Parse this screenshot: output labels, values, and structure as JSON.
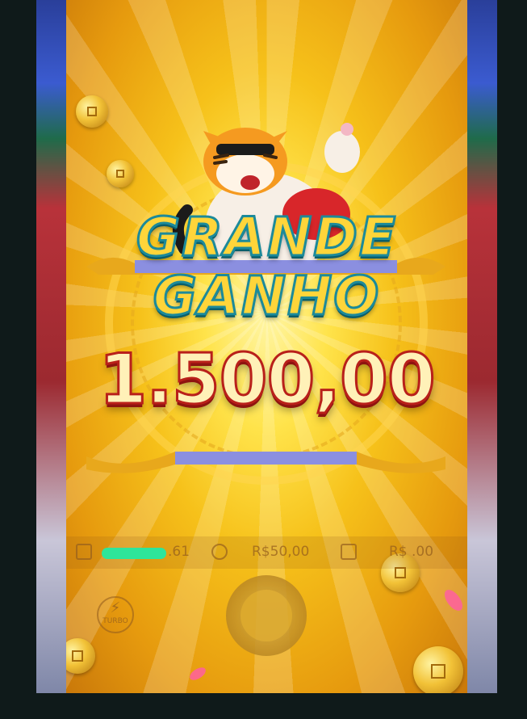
{
  "game": {
    "title_line1": "GRANDE",
    "title_line2": "GANHO",
    "win_amount": "1.500,00"
  },
  "bottom_bar": {
    "balance_suffix": ".61",
    "bet": "R$50,00",
    "win": "R$ .00"
  },
  "controls": {
    "turbo_label": "TURBO"
  },
  "colors": {
    "title_fill": "#ffd53a",
    "title_stroke": "#1c8a9a",
    "amount_fill": "#fff1b8",
    "amount_stroke": "#b9201a",
    "ribbon": "#8b8fe0",
    "redaction": "#2ee59a"
  }
}
